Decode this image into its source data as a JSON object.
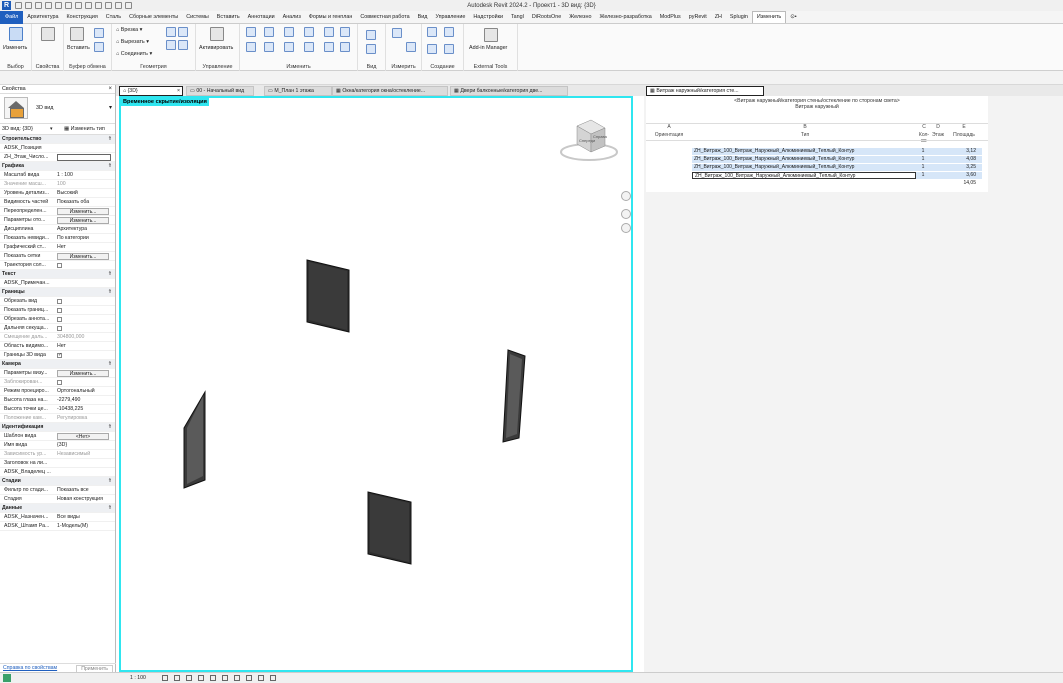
{
  "app": {
    "title": "Autodesk Revit 2024.2 - Проект1 - 3D вид: {3D}",
    "logo": "R"
  },
  "menu": {
    "file": "Файл",
    "tabs": [
      "Архитектура",
      "Конструкция",
      "Сталь",
      "Сборные элементы",
      "Системы",
      "Вставить",
      "Аннотации",
      "Анализ",
      "Формы и генплан",
      "Совместная работа",
      "Вид",
      "Управление",
      "Надстройки",
      "Tangl",
      "DiRootsOne",
      "Железно",
      "Железно-разработка",
      "ModPlus",
      "pyRevit",
      "ZH",
      "Splugin"
    ],
    "active": "Изменить",
    "extra": "⊙•"
  },
  "ribbon": {
    "modify_label": "Изменить",
    "properties_label": "Свойства",
    "paste_label": "Вставить",
    "cut_label": "Врезка",
    "cut2_label": "Вырезать",
    "join_label": "Соединить",
    "activate_label": "Активировать",
    "addin_manager_label": "Add-in Manager",
    "groups": {
      "select": "Выбор",
      "properties": "Свойства",
      "clipboard": "Буфер обмена",
      "geometry": "Геометрия",
      "control": "Управление",
      "modify": "Изменить",
      "view": "Вид",
      "measure": "Измерить",
      "create": "Создание",
      "external": "External Tools"
    }
  },
  "properties": {
    "header": "Свойства",
    "type_name": "3D вид",
    "selector_value": "3D вид: {3D}",
    "edit_type": "Изменить тип",
    "rows": [
      {
        "kind": "cat",
        "name": "Строительство"
      },
      {
        "kind": "row",
        "name": "ADSK_Позиция",
        "value": ""
      },
      {
        "kind": "input",
        "name": "ZH_Этаж_Число...",
        "value": ""
      },
      {
        "kind": "cat",
        "name": "Графика"
      },
      {
        "kind": "row",
        "name": "Масштаб вида",
        "value": "1 : 100"
      },
      {
        "kind": "dim",
        "name": "Значение масш...",
        "value": "100"
      },
      {
        "kind": "row",
        "name": "Уровень детализ...",
        "value": "Высокий"
      },
      {
        "kind": "row",
        "name": "Видимость частей",
        "value": "Показать оба"
      },
      {
        "kind": "btn",
        "name": "Переопределен...",
        "value": "Изменить..."
      },
      {
        "kind": "btn",
        "name": "Параметры ото...",
        "value": "Изменить..."
      },
      {
        "kind": "row",
        "name": "Дисциплина",
        "value": "Архитектура"
      },
      {
        "kind": "row",
        "name": "Показать невиди...",
        "value": "По категории"
      },
      {
        "kind": "row",
        "name": "Графический ст...",
        "value": "Нет"
      },
      {
        "kind": "btn",
        "name": "Показать сетки",
        "value": "Изменить..."
      },
      {
        "kind": "chk",
        "name": "Траектория сол...",
        "value": ""
      },
      {
        "kind": "cat",
        "name": "Текст"
      },
      {
        "kind": "row",
        "name": "ADSK_Примечан...",
        "value": ""
      },
      {
        "kind": "cat",
        "name": "Границы"
      },
      {
        "kind": "chk",
        "name": "Обрезать вид",
        "value": ""
      },
      {
        "kind": "chk",
        "name": "Показать границ...",
        "value": ""
      },
      {
        "kind": "chk",
        "name": "Обрезать аннота...",
        "value": ""
      },
      {
        "kind": "chk",
        "name": "Дальняя секуща...",
        "value": ""
      },
      {
        "kind": "dim",
        "name": "Смещение даль...",
        "value": "304800,000"
      },
      {
        "kind": "row",
        "name": "Область видимо...",
        "value": "Нет"
      },
      {
        "kind": "chkon",
        "name": "Границы 3D вида",
        "value": ""
      },
      {
        "kind": "cat",
        "name": "Камера"
      },
      {
        "kind": "btn",
        "name": "Параметры визу...",
        "value": "Изменить..."
      },
      {
        "kind": "chkdim",
        "name": "Заблокирован...",
        "value": ""
      },
      {
        "kind": "row",
        "name": "Режим проециро...",
        "value": "Ортогональный"
      },
      {
        "kind": "row",
        "name": "Высота глаза на...",
        "value": "-2279,490"
      },
      {
        "kind": "row",
        "name": "Высота точки це...",
        "value": "-10438,225"
      },
      {
        "kind": "dim",
        "name": "Положение кам...",
        "value": "Регулировка"
      },
      {
        "kind": "cat",
        "name": "Идентификация"
      },
      {
        "kind": "btn",
        "name": "Шаблон вида",
        "value": "<Нет>"
      },
      {
        "kind": "row",
        "name": "Имя вида",
        "value": "{3D}"
      },
      {
        "kind": "dim",
        "name": "Зависимость ур...",
        "value": "Независимый"
      },
      {
        "kind": "row",
        "name": "Заголовок на ли...",
        "value": ""
      },
      {
        "kind": "row",
        "name": "ADSK_Владелец ...",
        "value": ""
      },
      {
        "kind": "cat",
        "name": "Стадии"
      },
      {
        "kind": "row",
        "name": "Фильтр по стади...",
        "value": "Показать все"
      },
      {
        "kind": "row",
        "name": "Стадия",
        "value": "Новая конструкция"
      },
      {
        "kind": "cat",
        "name": "Данные"
      },
      {
        "kind": "row",
        "name": "ADSK_Назначен...",
        "value": "Все виды"
      },
      {
        "kind": "row",
        "name": "ADSK_Штамп Ра...",
        "value": "1-Модель(М)"
      }
    ],
    "help": "Справка по свойствам",
    "apply": "Применить"
  },
  "view_tabs": [
    {
      "label": "{3D}",
      "active": true
    },
    {
      "label": "00 - Начальный вид",
      "active": false
    },
    {
      "label": "М_План 1 этажа",
      "active": false
    },
    {
      "label": "Окна/категория окна/остекление...",
      "active": false
    },
    {
      "label": "Двери балконные/категория две...",
      "active": false
    },
    {
      "label": "Витраж наружный/категория сте...",
      "active": true
    }
  ],
  "view3d": {
    "temp_hide_label": "Временное скрытие/изоляция",
    "viewcube_front": "Спереди",
    "viewcube_right": "Справа"
  },
  "status": {
    "scale": "1 : 100"
  },
  "schedule": {
    "title_line1": "<Витраж наружный/категория стены/остекление по сторонам света>",
    "title_line2": "Витраж наружный",
    "col_letters": [
      "A",
      "B",
      "C",
      "D",
      "E"
    ],
    "col_headers": [
      "Ориентация",
      "Тип",
      "Кол-во",
      "Этаж",
      "Площадь"
    ],
    "rows": [
      {
        "type": "ZH_Витраж_100_Витраж_Наружный_Алюминиевый_Теплый_Контур",
        "count": "1",
        "area": "3,12"
      },
      {
        "type": "ZH_Витраж_100_Витраж_Наружный_Алюминиевый_Теплый_Контур",
        "count": "1",
        "area": "4,08"
      },
      {
        "type": "ZH_Витраж_100_Витраж_Наружный_Алюминиевый_Теплый_Контур",
        "count": "1",
        "area": "3,25"
      },
      {
        "type": "ZH_Витраж_100_Витраж_Наружный_Алюминиевый_Теплый_Контур",
        "count": "1",
        "area": "3,60"
      }
    ],
    "total": "14,05"
  }
}
